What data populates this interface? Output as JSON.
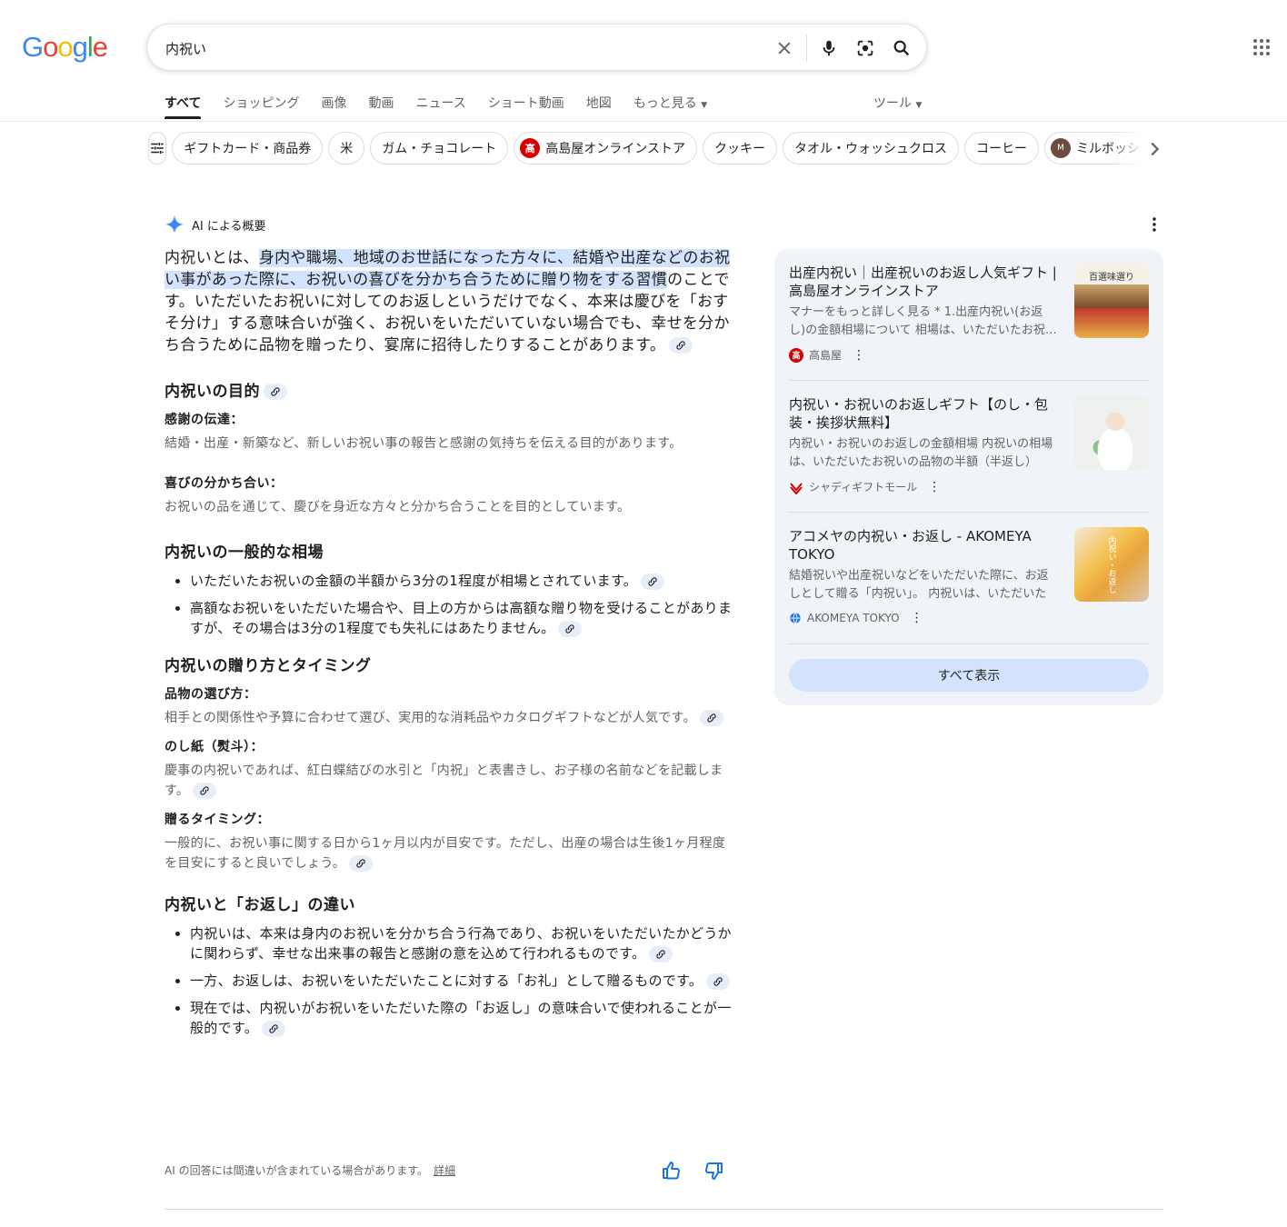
{
  "search": {
    "query": "内祝い"
  },
  "tabs": [
    "すべて",
    "ショッピング",
    "画像",
    "動画",
    "ニュース",
    "ショート動画",
    "地図",
    "もっと見る"
  ],
  "tools_label": "ツール",
  "chips": [
    "ギフトカード・商品券",
    "米",
    "ガム・チョコレート",
    "高島屋オンラインストア",
    "クッキー",
    "タオル・ウォッシュクロス",
    "コーヒー",
    "ミルボッシュ"
  ],
  "ai": {
    "header": "AI による概要",
    "intro_pre": "内祝いとは、",
    "intro_hl": "身内や職場、地域のお世話になった方々に、結婚や出産などのお祝い事があった際に、お祝いの喜びを分かち合うために贈り物をする習慣",
    "intro_post": "のことです。いただいたお祝いに対してのお返しというだけでなく、本来は慶びを「おすそ分け」する意味合いが強く、お祝いをいただいていない場合でも、幸せを分かち合うために品物を贈ったり、宴席に招待したりすることがあります。",
    "s1": {
      "title": "内祝いの目的",
      "items": [
        {
          "label": "感謝の伝達：",
          "text": "結婚・出産・新築など、新しいお祝い事の報告と感謝の気持ちを伝える目的があります。"
        },
        {
          "label": "喜びの分かち合い：",
          "text": "お祝いの品を通じて、慶びを身近な方々と分かち合うことを目的としています。"
        }
      ]
    },
    "s2": {
      "title": "内祝いの一般的な相場",
      "bullets": [
        "いただいたお祝いの金額の半額から3分の1程度が相場とされています。",
        "高額なお祝いをいただいた場合や、目上の方からは高額な贈り物を受けることがありますが、その場合は3分の1程度でも失礼にはあたりません。"
      ]
    },
    "s3": {
      "title": "内祝いの贈り方とタイミング",
      "items": [
        {
          "label": "品物の選び方：",
          "text": "相手との関係性や予算に合わせて選び、実用的な消耗品やカタログギフトなどが人気です。"
        },
        {
          "label": "のし紙（熨斗）：",
          "text": "慶事の内祝いであれば、紅白蝶結びの水引と「内祝」と表書きし、お子様の名前などを記載します。"
        },
        {
          "label": "贈るタイミング：",
          "text": "一般的に、お祝い事に関する日から1ヶ月以内が目安です。ただし、出産の場合は生後1ヶ月程度を目安にすると良いでしょう。"
        }
      ]
    },
    "s4": {
      "title": "内祝いと「お返し」の違い",
      "bullets": [
        "内祝いは、本来は身内のお祝いを分かち合う行為であり、お祝いをいただいたかどうかに関わらず、幸せな出来事の報告と感謝の意を込めて行われるものです。",
        "一方、お返しは、お祝いをいただいたことに対する「お礼」として贈るものです。",
        "現在では、内祝いがお祝いをいただいた際の「お返し」の意味合いで使われることが一般的です。"
      ]
    },
    "disclaimer": "AI の回答には間違いが含まれている場合があります。",
    "details_link": "詳細"
  },
  "sources": [
    {
      "title": "出産内祝い｜出産祝いのお返し人気ギフト | 高島屋オンラインストア",
      "snippet": "マナーをもっと詳しく見る * 1.出産内祝い(お返し)の金額相場について 相場は、いただいたお祝いの",
      "site": "高島屋",
      "thumb_text": "百選味選り"
    },
    {
      "title": "内祝い・お祝いのお返しギフト【のし・包装・挨拶状無料】",
      "snippet": "内祝い・お祝いのお返しの金額相場 内祝いの相場は、いただいたお祝いの品物の半額（半返し）",
      "site": "シャディギフトモール"
    },
    {
      "title": "アコメヤの内祝い・お返し - AKOMEYA TOKYO",
      "snippet": "結婚祝いや出産祝いなどをいただいた際に、お返しとして贈る「内祝い」。 内祝いは、いただいた",
      "site": "AKOMEYA TOKYO",
      "thumb_text": "内祝い・お返し"
    }
  ],
  "show_all": "すべて表示",
  "colors": {
    "accent": "#1a73e8",
    "chip_border": "#dadce0",
    "panel_bg": "#f0f4f9",
    "highlight": "#d3e3fd"
  }
}
